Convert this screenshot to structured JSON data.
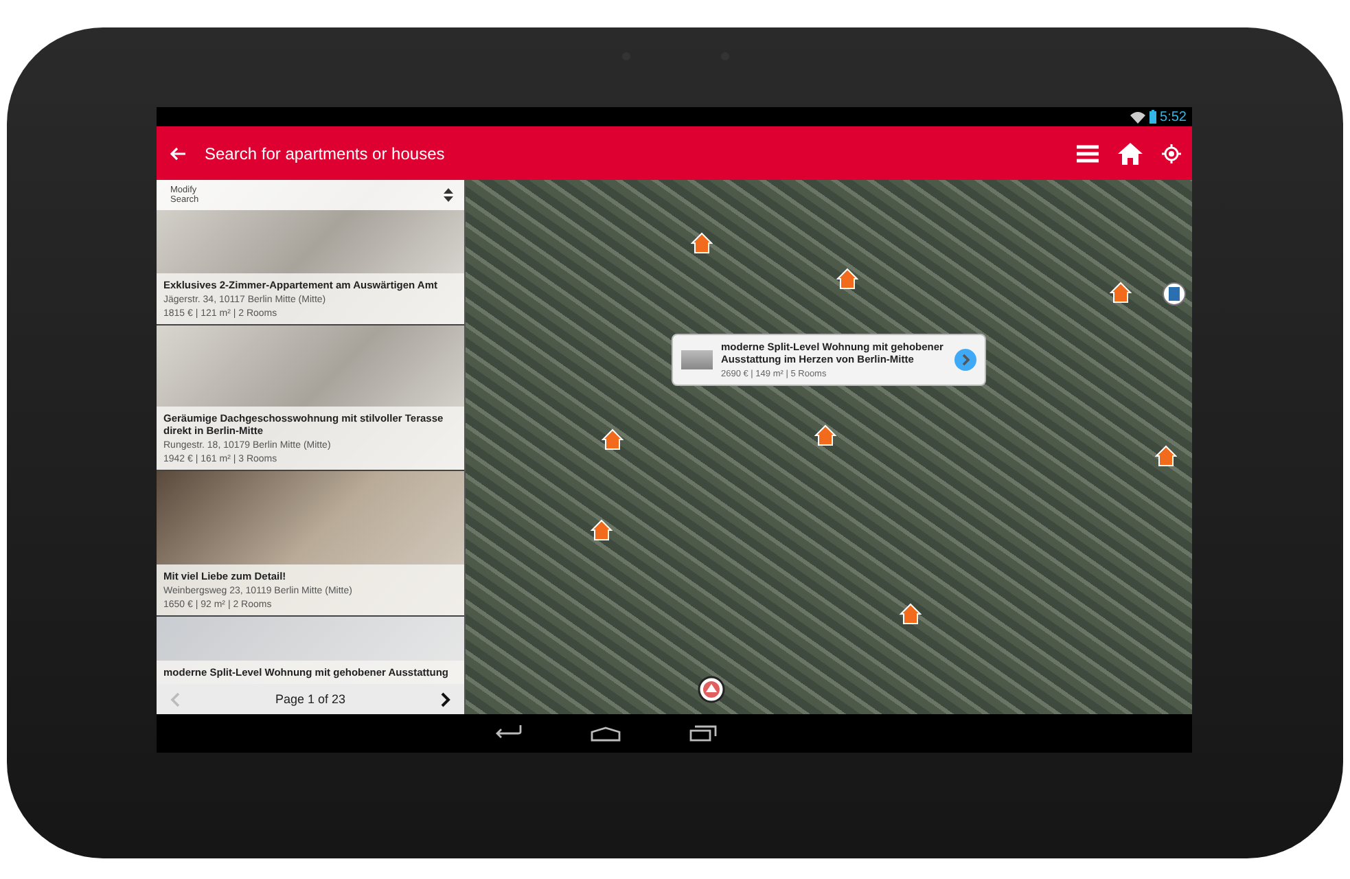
{
  "status_bar": {
    "time": "5:52"
  },
  "app_bar": {
    "title": "Search for apartments or houses"
  },
  "modify_search": {
    "label": "Modify Search"
  },
  "listings": [
    {
      "title": "Exklusives 2-Zimmer-Appartement am Auswärtigen Amt",
      "address": "Jägerstr. 34, 10117 Berlin Mitte (Mitte)",
      "details": "1815 € | 121 m² | 2 Rooms"
    },
    {
      "title": "Geräumige Dachgeschosswohnung mit stilvoller Terasse direkt in Berlin-Mitte",
      "address": "Rungestr. 18, 10179 Berlin Mitte (Mitte)",
      "details": "1942 € | 161 m² | 3 Rooms"
    },
    {
      "title": "Mit viel Liebe zum Detail!",
      "address": "Weinbergsweg 23, 10119 Berlin Mitte (Mitte)",
      "details": "1650 € | 92 m² | 2 Rooms"
    },
    {
      "title": "moderne Split-Level Wohnung mit gehobener Ausstattung"
    }
  ],
  "pagination": {
    "label": "Page 1 of 23"
  },
  "map": {
    "callout": {
      "title": "moderne Split-Level Wohnung mit gehobener Ausstattung im Herzen von Berlin-Mitte",
      "details": "2690 € | 149 m² | 5 Rooms"
    },
    "markers": [
      {
        "kind": "house"
      },
      {
        "kind": "house"
      },
      {
        "kind": "building"
      },
      {
        "kind": "house"
      },
      {
        "kind": "house"
      },
      {
        "kind": "house"
      },
      {
        "kind": "house"
      },
      {
        "kind": "house"
      },
      {
        "kind": "house"
      },
      {
        "kind": "location"
      }
    ]
  }
}
